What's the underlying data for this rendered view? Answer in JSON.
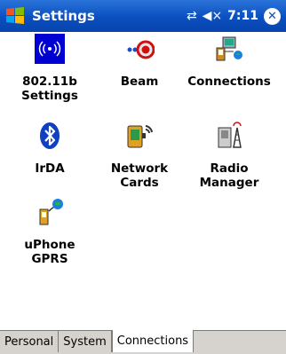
{
  "titlebar": {
    "title": "Settings",
    "clock": "7:11",
    "start_icon": "windows-flag-icon",
    "connectivity_icon": "connectivity-icon",
    "volume_icon": "speaker-muted-icon",
    "close_icon": "close-icon"
  },
  "tiles": [
    {
      "label": "802.11b\nSettings",
      "icon": "wifi-icon"
    },
    {
      "label": "Beam",
      "icon": "beam-icon"
    },
    {
      "label": "Connections",
      "icon": "connections-icon"
    },
    {
      "label": "IrDA",
      "icon": "bluetooth-icon"
    },
    {
      "label": "Network\nCards",
      "icon": "network-card-icon"
    },
    {
      "label": "Radio\nManager",
      "icon": "radio-manager-icon"
    },
    {
      "label": "uPhone\nGPRS",
      "icon": "uphone-icon"
    }
  ],
  "tabs": [
    {
      "label": "Personal"
    },
    {
      "label": "System"
    },
    {
      "label": "Connections",
      "active": true
    }
  ],
  "colors": {
    "titlebar": "#0a4fc0",
    "tabbar": "#d6d3ce"
  }
}
